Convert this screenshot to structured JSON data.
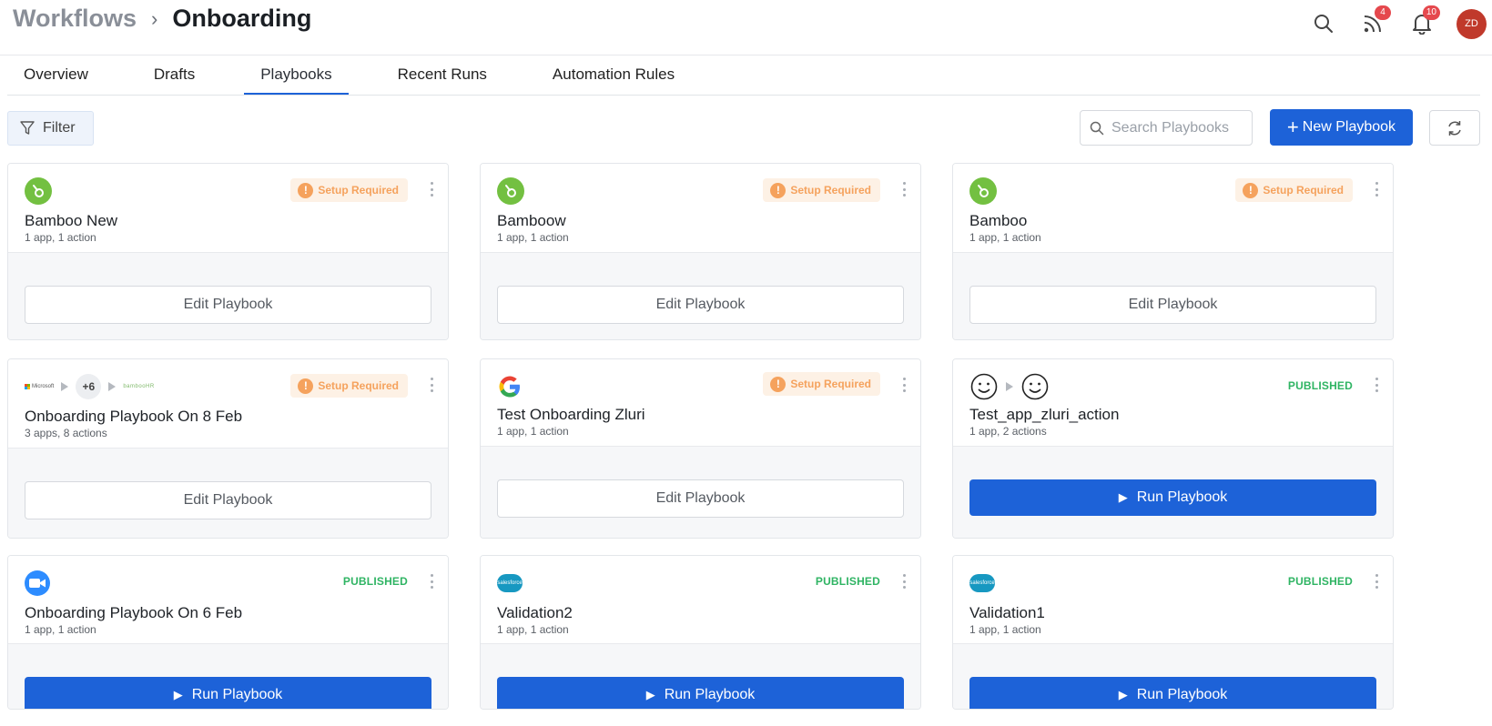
{
  "header": {
    "breadcrumb_parent": "Workflows",
    "breadcrumb_sep": "›",
    "breadcrumb_current": "Onboarding",
    "icons": [
      "search-icon",
      "rss-icon",
      "bell-icon"
    ],
    "feed_badge": "4",
    "notif_badge": "10",
    "avatar_initials": "ZD",
    "avatar_color": "#c0392b"
  },
  "tabs": [
    {
      "label": "Overview"
    },
    {
      "label": "Drafts"
    },
    {
      "label": "Playbooks",
      "active": true
    },
    {
      "label": "Recent Runs"
    },
    {
      "label": "Automation Rules"
    }
  ],
  "toolbar": {
    "filter_label": "Filter",
    "search_placeholder": "Search Playbooks",
    "new_button_label": "New Playbook"
  },
  "colors": {
    "primary": "#1d62d8",
    "warning": "#f5a25d",
    "published": "#2fb463"
  },
  "cards": [
    {
      "title": "Bamboo New",
      "subtitle": "1 app, 1 action",
      "status": "Setup Required",
      "action": "Edit Playbook",
      "icon": "bamboohr-icon"
    },
    {
      "title": "Bamboow",
      "subtitle": "1 app, 1 action",
      "status": "Setup Required",
      "action": "Edit Playbook",
      "icon": "bamboohr-icon"
    },
    {
      "title": "Bamboo",
      "subtitle": "1 app, 1 action",
      "status": "Setup Required",
      "action": "Edit Playbook",
      "icon": "bamboohr-icon"
    },
    {
      "title": "Onboarding Playbook On 8 Feb",
      "subtitle": "3 apps, 8 actions",
      "status": "Setup Required",
      "action": "Edit Playbook",
      "icon": "microsoft-icon",
      "more_apps": "+6",
      "ms_label": "Microsoft",
      "bamboo_label": "bambooHR"
    },
    {
      "title": "Test Onboarding Zluri",
      "subtitle": "1 app, 1 action",
      "status": "Setup Required",
      "action": "Edit Playbook",
      "icon": "google-icon"
    },
    {
      "title": "Test_app_zluri_action",
      "subtitle": "1 app, 2 actions",
      "status": "PUBLISHED",
      "action": "Run Playbook",
      "icon": "smiley-icon"
    },
    {
      "title": "Onboarding Playbook On 6 Feb",
      "subtitle": "1 app, 1 action",
      "status": "PUBLISHED",
      "action": "Run Playbook",
      "icon": "zoom-icon"
    },
    {
      "title": "Validation2",
      "subtitle": "1 app, 1 action",
      "status": "PUBLISHED",
      "action": "Run Playbook",
      "icon": "salesforce-icon",
      "logo_text": "salesforce"
    },
    {
      "title": "Validation1",
      "subtitle": "1 app, 1 action",
      "status": "PUBLISHED",
      "action": "Run Playbook",
      "icon": "salesforce-icon",
      "logo_text": "salesforce"
    }
  ]
}
